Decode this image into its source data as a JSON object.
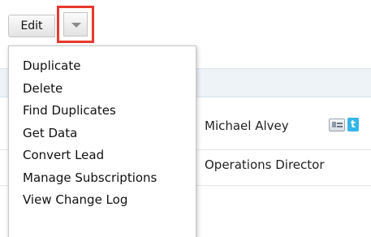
{
  "toolbar": {
    "edit_label": "Edit",
    "dropdown_icon": "caret-down-icon",
    "highlight_color": "#e8392c"
  },
  "menu": {
    "items": [
      {
        "label": "Duplicate"
      },
      {
        "label": "Delete"
      },
      {
        "label": "Find Duplicates"
      },
      {
        "label": "Get Data"
      },
      {
        "label": "Convert Lead"
      },
      {
        "label": "Manage Subscriptions"
      },
      {
        "label": "View Change Log"
      }
    ]
  },
  "record": {
    "name": "Michael Alvey",
    "title": "Operations Director",
    "icons": [
      "vcard-icon",
      "twitter-icon"
    ],
    "twitter_color": "#35b6e9"
  }
}
